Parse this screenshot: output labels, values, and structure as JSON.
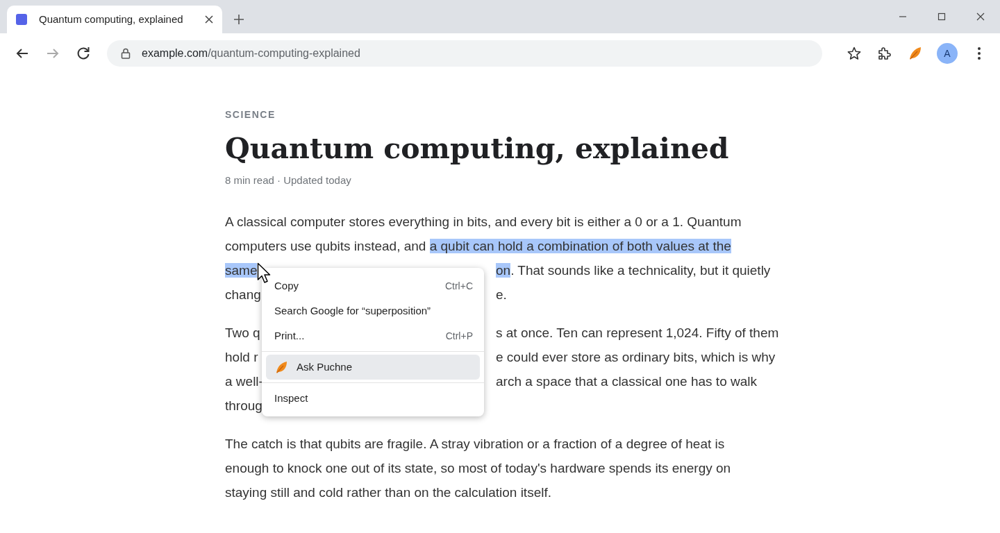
{
  "browser": {
    "tabs": [
      {
        "title": "Quantum computing, explained",
        "selected": true
      }
    ],
    "address": {
      "host": "example.com",
      "path": "/quantum-computing-explained"
    },
    "profile": {
      "initial": "A"
    }
  },
  "article": {
    "category": "SCIENCE",
    "title": "Quantum computing, explained",
    "meta": "8 min read · Updated today",
    "paragraphs": [
      {
        "lines": [
          {
            "left": [
              {
                "text": "A classical computer stores everything in bits, and every bit is either a 0 or a 1. Quantum",
                "selected": false
              }
            ]
          },
          {
            "left": [
              {
                "text": "computers use qubits instead, and ",
                "selected": false
              },
              {
                "text": "a qubit can hold a combination of both values at the",
                "selected": true
              }
            ]
          },
          {
            "left": [
              {
                "text": "same",
                "selected": true
              }
            ],
            "right": [
              {
                "text": "on",
                "selected": true
              },
              {
                "text": ". That sounds like a technicality, but it quietly",
                "selected": false
              }
            ]
          },
          {
            "left": [
              {
                "text": "chang",
                "selected": false
              }
            ],
            "right": [
              {
                "text": "e.",
                "selected": false
              }
            ]
          }
        ]
      },
      {
        "lines": [
          {
            "left": [
              {
                "text": "Two q",
                "selected": false
              }
            ],
            "right": [
              {
                "text": "s at once. Ten can represent 1,024. Fifty of them",
                "selected": false
              }
            ]
          },
          {
            "left": [
              {
                "text": "hold r",
                "selected": false
              }
            ],
            "right": [
              {
                "text": "e could ever store as ordinary bits, which is why",
                "selected": false
              }
            ]
          },
          {
            "left": [
              {
                "text": "a well-",
                "selected": false
              }
            ],
            "right": [
              {
                "text": "arch a space that a classical one has to walk",
                "selected": false
              }
            ]
          },
          {
            "left": [
              {
                "text": "throug",
                "selected": false
              }
            ]
          }
        ]
      },
      {
        "lines": [
          {
            "left": [
              {
                "text": "The catch is that qubits are fragile. A stray vibration or a fraction of a degree of heat is",
                "selected": false
              }
            ]
          },
          {
            "left": [
              {
                "text": "enough to knock one out of its state, so most of today's hardware spends its energy on",
                "selected": false
              }
            ]
          },
          {
            "left": [
              {
                "text": "staying still and cold rather than on the calculation itself.",
                "selected": false
              }
            ]
          }
        ]
      }
    ]
  },
  "context_menu": {
    "items": [
      {
        "kind": "item",
        "label": "Copy",
        "shortcut": "Ctrl+C",
        "highlighted": false
      },
      {
        "kind": "item",
        "label": "Search Google for “superposition”",
        "highlighted": false
      },
      {
        "kind": "item",
        "label": "Print...",
        "shortcut": "Ctrl+P",
        "highlighted": false
      },
      {
        "kind": "separator"
      },
      {
        "kind": "extension",
        "label": "Ask Puchne",
        "highlighted": true
      },
      {
        "kind": "separator"
      },
      {
        "kind": "item",
        "label": "Inspect",
        "highlighted": false
      }
    ]
  }
}
